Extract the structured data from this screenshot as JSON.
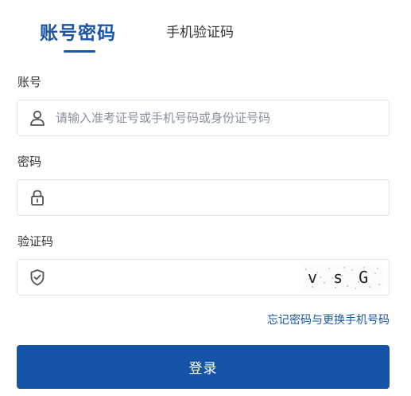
{
  "tabs": {
    "active_label": "账号密码",
    "inactive_label": "手机验证码"
  },
  "account": {
    "label": "账号",
    "placeholder": "请输入准考证号或手机号码或身份证号码",
    "value": ""
  },
  "password": {
    "label": "密码",
    "value": ""
  },
  "captcha": {
    "label": "验证码",
    "value": "",
    "image_text": "v s G W"
  },
  "links": {
    "forgot": "忘记密码与更换手机号码"
  },
  "login_button": {
    "label": "登录"
  },
  "icons": {
    "account": "user-icon",
    "password": "lock-icon",
    "captcha": "shield-check-icon"
  },
  "colors": {
    "primary": "#1a55a6",
    "button": "#1553a6",
    "border": "#e3e5ea",
    "placeholder": "#8a8f99"
  }
}
